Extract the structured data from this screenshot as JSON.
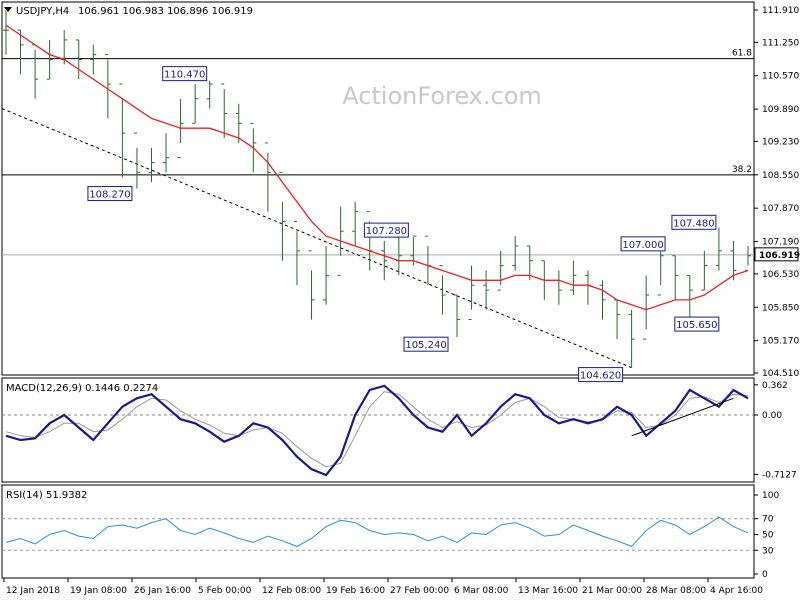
{
  "header": {
    "symbol": "USDJPY,H4",
    "ohlc": "106.961 106.983 106.896 106.919",
    "menu_icon": "dropdown-triangle-icon"
  },
  "watermark": "ActionForex.com",
  "colors": {
    "price_bars": "#2a6a2a",
    "ma": "#e8232a",
    "macd": "#1a1a8c",
    "signal": "#999999",
    "rsi": "#2f8fd8",
    "label_border": "#1a1a8c",
    "trendline": "#000000",
    "level_line": "#000000",
    "current_price_box": "#ffffff"
  },
  "x_axis": {
    "labels": [
      "12 Jan 2018",
      "19 Jan 08:00",
      "26 Jan 16:00",
      "5 Feb 00:00",
      "12 Feb 08:00",
      "19 Feb 16:00",
      "27 Feb 00:00",
      "6 Mar 08:00",
      "13 Mar 16:00",
      "21 Mar 00:00",
      "28 Mar 08:00",
      "4 Apr 16:00"
    ]
  },
  "chart_data": [
    {
      "type": "line",
      "panel": "price",
      "title": "USDJPY,H4",
      "y_ticks": [
        "111.910",
        "111.250",
        "110.570",
        "109.890",
        "109.230",
        "108.550",
        "107.870",
        "107.190",
        "106.530",
        "105.850",
        "105.170",
        "104.510"
      ],
      "ylim": [
        104.51,
        111.91
      ],
      "current_price": "106.919",
      "levels": [
        {
          "label": "61.8",
          "value": 110.92
        },
        {
          "label": "38.2",
          "value": 108.55
        }
      ],
      "horizontal_line": 106.919,
      "annotations": [
        {
          "text": "110.470",
          "value": 110.47
        },
        {
          "text": "108.270",
          "value": 108.27
        },
        {
          "text": "107.280",
          "value": 107.28
        },
        {
          "text": "105.240",
          "value": 105.24
        },
        {
          "text": "104.620",
          "value": 104.62
        },
        {
          "text": "107.000",
          "value": 107.0
        },
        {
          "text": "105.650",
          "value": 105.65
        },
        {
          "text": "107.480",
          "value": 107.48
        }
      ],
      "series": [
        {
          "name": "close",
          "values": [
            111.5,
            111.2,
            110.5,
            110.9,
            111.3,
            110.9,
            111.0,
            110.4,
            109.4,
            108.6,
            108.8,
            108.9,
            109.6,
            110.1,
            110.4,
            109.8,
            109.6,
            109.2,
            108.6,
            107.6,
            107.0,
            106.0,
            106.5,
            107.4,
            107.8,
            107.0,
            106.8,
            106.9,
            107.3,
            106.7,
            106.1,
            105.6,
            106.3,
            106.2,
            106.7,
            107.1,
            106.8,
            106.4,
            106.2,
            106.5,
            106.3,
            106.0,
            105.7,
            105.2,
            106.1,
            106.9,
            106.5,
            106.2,
            106.7,
            107.0,
            106.6,
            106.9
          ],
          "high": [
            111.9,
            111.5,
            111.1,
            111.3,
            111.5,
            111.3,
            111.2,
            110.9,
            110.1,
            109.1,
            109.1,
            109.4,
            110.1,
            110.4,
            110.47,
            110.3,
            110.0,
            109.5,
            109.0,
            108.0,
            107.4,
            106.6,
            107.1,
            107.9,
            108.0,
            107.6,
            107.2,
            107.3,
            107.28,
            107.1,
            106.5,
            106.1,
            106.7,
            106.6,
            107.0,
            107.3,
            107.1,
            106.8,
            106.6,
            106.8,
            106.6,
            106.4,
            106.0,
            105.8,
            106.5,
            107.1,
            106.9,
            106.5,
            107.0,
            107.48,
            107.2,
            107.1
          ],
          "low": [
            111.0,
            110.6,
            110.1,
            110.5,
            110.8,
            110.5,
            110.6,
            109.7,
            108.5,
            108.27,
            108.4,
            108.6,
            109.2,
            109.6,
            109.9,
            109.3,
            109.2,
            108.6,
            107.8,
            106.8,
            106.3,
            105.6,
            105.9,
            106.9,
            107.1,
            106.6,
            106.4,
            106.5,
            106.7,
            106.3,
            105.7,
            105.24,
            105.8,
            105.8,
            106.3,
            106.6,
            106.4,
            106.0,
            105.9,
            106.1,
            105.9,
            105.6,
            105.2,
            104.62,
            105.4,
            106.3,
            106.0,
            105.65,
            106.2,
            106.6,
            106.4,
            106.7
          ]
        },
        {
          "name": "ma",
          "values": [
            111.6,
            111.4,
            111.2,
            111.0,
            110.9,
            110.7,
            110.5,
            110.3,
            110.1,
            109.9,
            109.7,
            109.6,
            109.5,
            109.5,
            109.5,
            109.4,
            109.3,
            109.1,
            108.8,
            108.4,
            108.0,
            107.6,
            107.3,
            107.2,
            107.1,
            107.0,
            106.9,
            106.8,
            106.8,
            106.7,
            106.6,
            106.5,
            106.4,
            106.4,
            106.4,
            106.5,
            106.5,
            106.4,
            106.4,
            106.3,
            106.3,
            106.2,
            106.0,
            105.9,
            105.8,
            105.9,
            106.0,
            106.0,
            106.1,
            106.3,
            106.5,
            106.6
          ]
        }
      ],
      "trendline": {
        "from": 109.9,
        "to": 104.62
      }
    },
    {
      "type": "line",
      "panel": "macd",
      "title": "MACD(12,26,9) 0.1446 0.2274",
      "y_ticks": [
        "0.362",
        "0.00",
        "-0.7127"
      ],
      "ylim": [
        -0.78,
        0.42
      ],
      "series": [
        {
          "name": "MACD",
          "values": [
            -0.25,
            -0.3,
            -0.28,
            -0.1,
            0.0,
            -0.15,
            -0.3,
            -0.1,
            0.1,
            0.2,
            0.25,
            0.1,
            -0.05,
            -0.1,
            -0.2,
            -0.32,
            -0.25,
            -0.1,
            -0.15,
            -0.3,
            -0.5,
            -0.65,
            -0.72,
            -0.5,
            0.0,
            0.3,
            0.35,
            0.2,
            0.0,
            -0.15,
            -0.2,
            0.0,
            -0.25,
            -0.1,
            0.1,
            0.25,
            0.2,
            0.0,
            -0.1,
            -0.05,
            -0.1,
            -0.05,
            0.1,
            0.0,
            -0.25,
            -0.1,
            0.05,
            0.3,
            0.2,
            0.1,
            0.3,
            0.2
          ]
        },
        {
          "name": "Signal",
          "values": [
            -0.2,
            -0.25,
            -0.27,
            -0.2,
            -0.1,
            -0.1,
            -0.2,
            -0.18,
            -0.05,
            0.1,
            0.2,
            0.18,
            0.05,
            -0.05,
            -0.12,
            -0.22,
            -0.25,
            -0.18,
            -0.15,
            -0.22,
            -0.38,
            -0.52,
            -0.62,
            -0.58,
            -0.25,
            0.1,
            0.28,
            0.25,
            0.1,
            -0.05,
            -0.15,
            -0.08,
            -0.15,
            -0.12,
            0.0,
            0.15,
            0.2,
            0.1,
            -0.03,
            -0.05,
            -0.08,
            -0.06,
            0.05,
            0.03,
            -0.15,
            -0.12,
            0.0,
            0.2,
            0.22,
            0.15,
            0.25,
            0.23
          ]
        }
      ],
      "trendline": {
        "from": -0.25,
        "to": 0.2
      }
    },
    {
      "type": "line",
      "panel": "rsi",
      "title": "RSI(14) 51.9382",
      "y_ticks": [
        "100",
        "70",
        "50",
        "30",
        "0"
      ],
      "ylim": [
        0,
        100
      ],
      "reference_levels": [
        70,
        30
      ],
      "series": [
        {
          "name": "RSI",
          "values": [
            40,
            45,
            38,
            50,
            55,
            48,
            45,
            60,
            62,
            58,
            65,
            70,
            55,
            50,
            58,
            52,
            45,
            40,
            48,
            42,
            35,
            45,
            60,
            68,
            65,
            55,
            50,
            52,
            50,
            42,
            48,
            40,
            52,
            50,
            62,
            65,
            58,
            48,
            50,
            62,
            55,
            48,
            42,
            35,
            55,
            68,
            62,
            50,
            60,
            72,
            60,
            52
          ]
        }
      ]
    }
  ]
}
